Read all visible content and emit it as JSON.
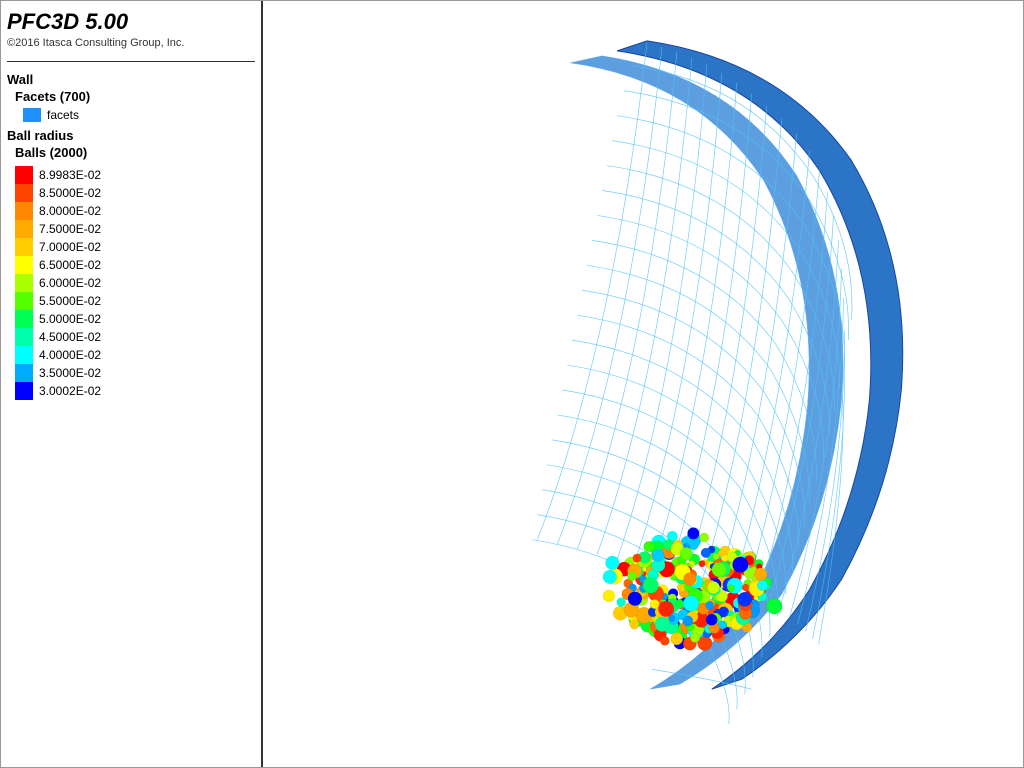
{
  "app": {
    "title": "PFC3D 5.00",
    "subtitle": "©2016 Itasca Consulting Group, Inc."
  },
  "legend": {
    "wall_title": "Wall",
    "facets_label": "Facets (700)",
    "facets_color": "#1E90FF",
    "facets_text": "facets",
    "ball_radius_title": "Ball radius",
    "balls_label": "Balls (2000)",
    "scale": [
      {
        "label": "8.9983E-02",
        "color": "#FF0000"
      },
      {
        "label": "8.5000E-02",
        "color": "#FF4400"
      },
      {
        "label": "8.0000E-02",
        "color": "#FF8800"
      },
      {
        "label": "7.5000E-02",
        "color": "#FFAA00"
      },
      {
        "label": "7.0000E-02",
        "color": "#FFCC00"
      },
      {
        "label": "6.5000E-02",
        "color": "#FFFF00"
      },
      {
        "label": "6.0000E-02",
        "color": "#AAFF00"
      },
      {
        "label": "5.5000E-02",
        "color": "#55FF00"
      },
      {
        "label": "5.0000E-02",
        "color": "#00FF55"
      },
      {
        "label": "4.5000E-02",
        "color": "#00FFAA"
      },
      {
        "label": "4.0000E-02",
        "color": "#00FFFF"
      },
      {
        "label": "3.5000E-02",
        "color": "#00AAFF"
      },
      {
        "label": "3.0002E-02",
        "color": "#0000FF"
      }
    ]
  }
}
